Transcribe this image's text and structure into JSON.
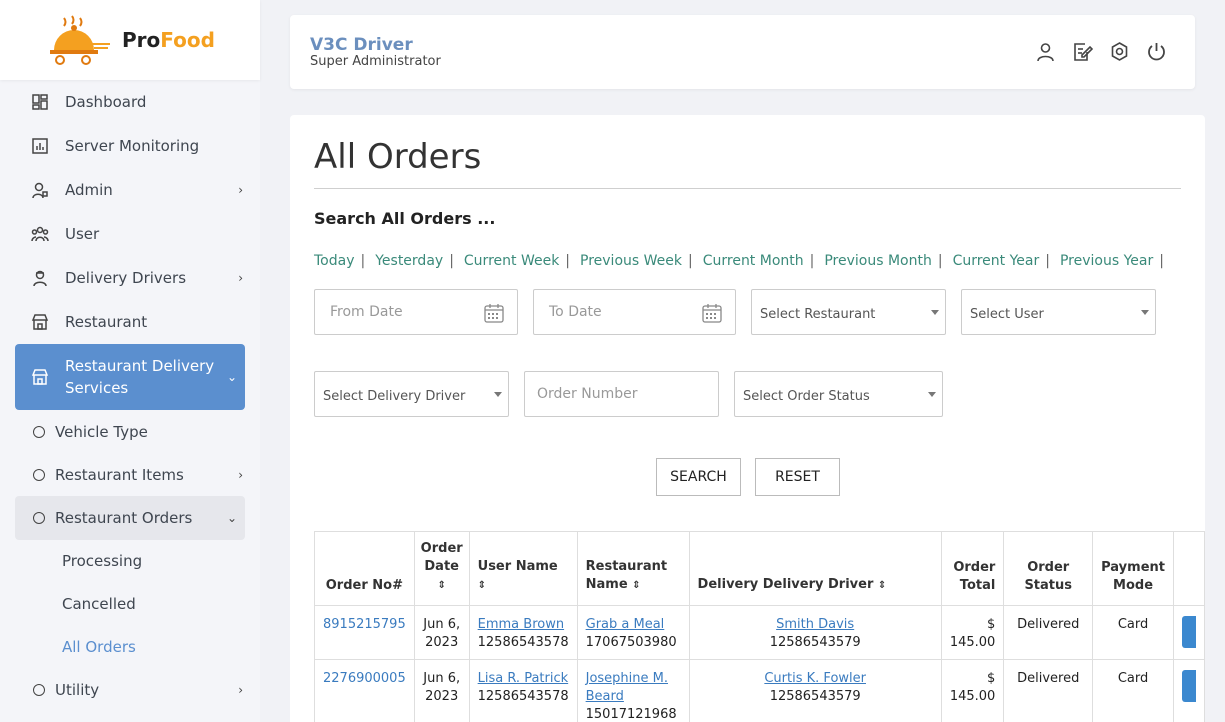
{
  "brand": {
    "pro": "Pro",
    "food": "Food"
  },
  "sidebar": {
    "items": [
      {
        "label": "Dashboard",
        "icon": "dashboard-icon"
      },
      {
        "label": "Server Monitoring",
        "icon": "chart-icon"
      },
      {
        "label": "Admin",
        "icon": "admin-icon",
        "chevron": "›"
      },
      {
        "label": "User",
        "icon": "users-icon"
      },
      {
        "label": "Delivery Drivers",
        "icon": "driver-icon",
        "chevron": "›"
      },
      {
        "label": "Restaurant",
        "icon": "store-icon"
      },
      {
        "label": "Restaurant Delivery Services",
        "icon": "store-icon",
        "chevron": "⌄"
      },
      {
        "label": "Vehicle Type"
      },
      {
        "label": "Restaurant Items",
        "chevron": "›"
      },
      {
        "label": "Restaurant Orders",
        "chevron": "⌄"
      },
      {
        "label": "Processing"
      },
      {
        "label": "Cancelled"
      },
      {
        "label": "All Orders"
      },
      {
        "label": "Utility",
        "chevron": "›"
      }
    ]
  },
  "header": {
    "name": "V3C Driver",
    "role": "Super Administrator"
  },
  "page": {
    "title": "All Orders",
    "subtitle": "Search All Orders ...",
    "quick_filters": [
      "Today",
      "Yesterday",
      "Current Week",
      "Previous Week",
      "Current Month",
      "Previous Month",
      "Current Year",
      "Previous Year"
    ],
    "separator": "|",
    "filters": {
      "from_date": "From Date",
      "to_date": "To Date",
      "restaurant": "Select Restaurant",
      "user": "Select User",
      "driver": "Select Delivery Driver",
      "order_number": "Order Number",
      "status": "Select Order Status"
    },
    "search_label": "SEARCH",
    "reset_label": "RESET"
  },
  "table": {
    "headers": {
      "order_no": "Order No#",
      "order_date": "Order Date",
      "user_name": "User Name",
      "restaurant_name": "Restaurant Name",
      "driver": "Delivery Delivery Driver",
      "total": "Order Total",
      "status": "Order Status",
      "payment": "Payment Mode"
    },
    "sort_glyph": "⇕",
    "rows": [
      {
        "order_no": "8915215795",
        "date_line1": "Jun 6,",
        "date_line2": "2023",
        "user_name": "Emma Brown",
        "user_phone": "12586543578",
        "restaurant_line1": "Grab a Meal",
        "restaurant_line2": "",
        "restaurant_phone": "17067503980",
        "driver_name": "Smith Davis",
        "driver_phone": "12586543579",
        "total_line1": "$",
        "total_line2": "145.00",
        "status": "Delivered",
        "payment": "Card"
      },
      {
        "order_no": "2276900005",
        "date_line1": "Jun 6,",
        "date_line2": "2023",
        "user_name": "Lisa R. Patrick",
        "user_phone": "12586543578",
        "restaurant_line1": "Josephine M.",
        "restaurant_line2": "Beard",
        "restaurant_phone": "15017121968",
        "driver_name": "Curtis K. Fowler",
        "driver_phone": "12586543579",
        "total_line1": "$",
        "total_line2": "145.00",
        "status": "Delivered",
        "payment": "Card"
      }
    ]
  },
  "colors": {
    "accent": "#5b8fcf",
    "link": "#3a7bbf",
    "quick_link": "#3a8a7a",
    "brand_orange": "#f4a020"
  }
}
